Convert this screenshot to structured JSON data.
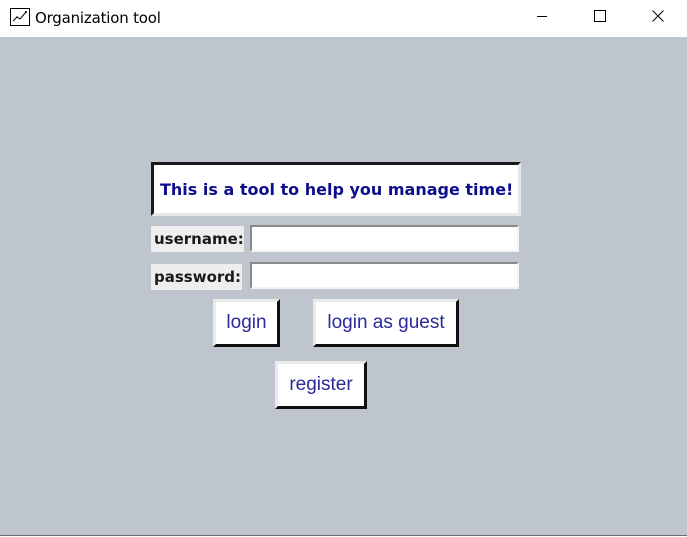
{
  "window": {
    "title": "Organization tool",
    "icons": {
      "app": "app-graph-icon",
      "minimize": "minimize-icon",
      "maximize": "maximize-icon",
      "close": "close-icon"
    }
  },
  "main": {
    "banner_text": "This is a tool to help you manage time!",
    "username_label": "username:",
    "password_label": "password:",
    "username_value": "",
    "password_value": "",
    "buttons": {
      "login": "login",
      "login_guest": "login as guest",
      "register": "register"
    }
  },
  "colors": {
    "background": "#bec5cc",
    "banner_text": "#0e0e8c",
    "button_text": "#2a2a9a"
  }
}
